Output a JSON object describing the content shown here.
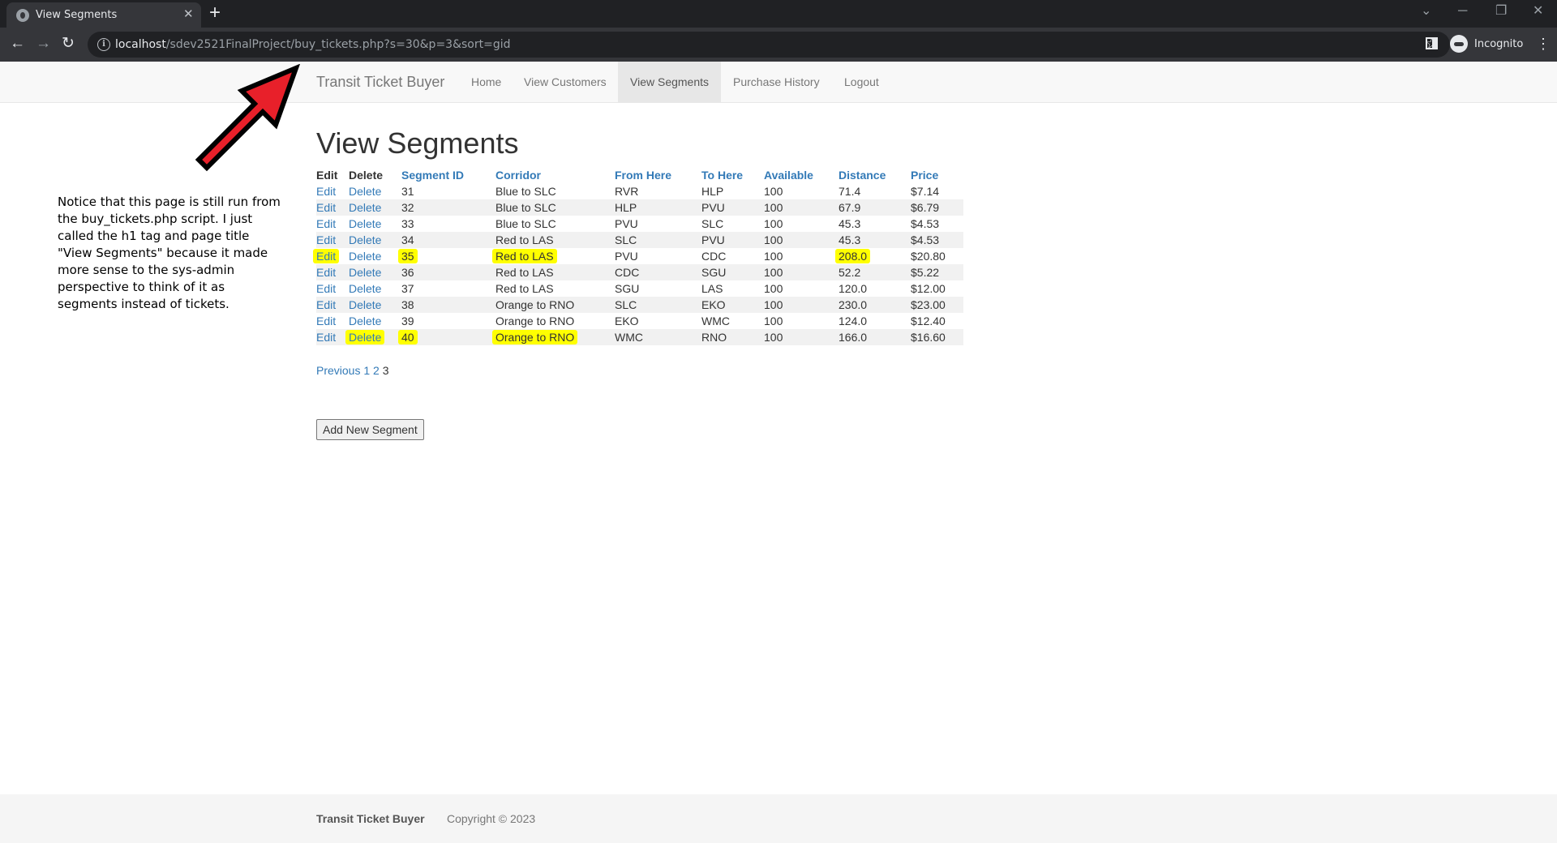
{
  "browser": {
    "tab_title": "View Segments",
    "tab_close": "✕",
    "new_tab": "+",
    "url_host": "localhost",
    "url_path": "/sdev2521FinalProject/buy_tickets.php?s=30&p=3&sort=gid",
    "profile_label": "Incognito",
    "icons": [
      "back-icon",
      "forward-icon",
      "reload-icon",
      "info-icon",
      "star-icon",
      "side-panel-icon",
      "incognito-icon",
      "menu-icon"
    ]
  },
  "navbar": {
    "brand": "Transit Ticket Buyer",
    "links": [
      "Home",
      "View Customers",
      "View Segments",
      "Purchase History",
      "Logout"
    ],
    "active": "View Segments"
  },
  "annotation": {
    "text": "Notice that this page is still run from the buy_tickets.php script. I just called the h1 tag and page title \"View Segments\" because it made more sense to the sys-admin perspective to think of it as segments instead of tickets.",
    "arrow_color": "#e8202a",
    "highlight_color": "#ffff00"
  },
  "page": {
    "title": "View Segments"
  },
  "table": {
    "headers": [
      "Edit",
      "Delete",
      "Segment ID",
      "Corridor",
      "From Here",
      "To Here",
      "Available",
      "Distance",
      "Price"
    ],
    "edit_label": "Edit",
    "delete_label": "Delete",
    "rows": [
      {
        "id": "31",
        "corridor": "Blue to SLC",
        "from": "RVR",
        "to": "HLP",
        "available": "100",
        "distance": "71.4",
        "price": "$7.14"
      },
      {
        "id": "32",
        "corridor": "Blue to SLC",
        "from": "HLP",
        "to": "PVU",
        "available": "100",
        "distance": "67.9",
        "price": "$6.79"
      },
      {
        "id": "33",
        "corridor": "Blue to SLC",
        "from": "PVU",
        "to": "SLC",
        "available": "100",
        "distance": "45.3",
        "price": "$4.53"
      },
      {
        "id": "34",
        "corridor": "Red to LAS",
        "from": "SLC",
        "to": "PVU",
        "available": "100",
        "distance": "45.3",
        "price": "$4.53"
      },
      {
        "id": "35",
        "corridor": "Red to LAS",
        "from": "PVU",
        "to": "CDC",
        "available": "100",
        "distance": "208.0",
        "price": "$20.80"
      },
      {
        "id": "36",
        "corridor": "Red to LAS",
        "from": "CDC",
        "to": "SGU",
        "available": "100",
        "distance": "52.2",
        "price": "$5.22"
      },
      {
        "id": "37",
        "corridor": "Red to LAS",
        "from": "SGU",
        "to": "LAS",
        "available": "100",
        "distance": "120.0",
        "price": "$12.00"
      },
      {
        "id": "38",
        "corridor": "Orange to RNO",
        "from": "SLC",
        "to": "EKO",
        "available": "100",
        "distance": "230.0",
        "price": "$23.00"
      },
      {
        "id": "39",
        "corridor": "Orange to RNO",
        "from": "EKO",
        "to": "WMC",
        "available": "100",
        "distance": "124.0",
        "price": "$12.40"
      },
      {
        "id": "40",
        "corridor": "Orange to RNO",
        "from": "WMC",
        "to": "RNO",
        "available": "100",
        "distance": "166.0",
        "price": "$16.60"
      }
    ]
  },
  "pager": {
    "previous": "Previous",
    "pages": [
      "1",
      "2",
      "3"
    ],
    "current": "3"
  },
  "add_button": "Add New Segment",
  "footer": {
    "brand": "Transit Ticket Buyer",
    "copyright": "Copyright © 2023"
  }
}
